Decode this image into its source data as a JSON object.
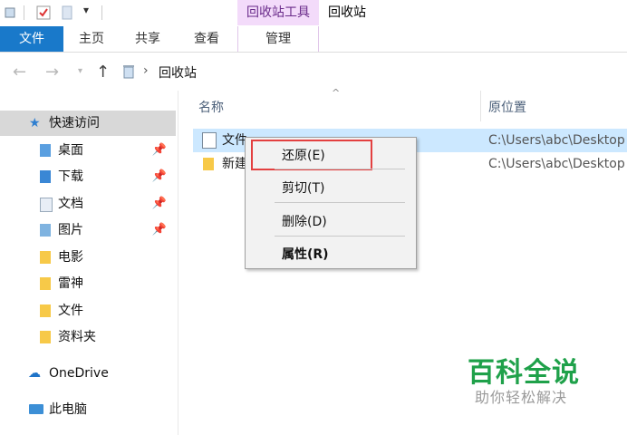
{
  "ribbon": {
    "context_group": "回收站工具",
    "window_title": "回收站",
    "tabs": [
      "文件",
      "主页",
      "共享",
      "查看",
      "管理"
    ]
  },
  "address": {
    "path": [
      "回收站"
    ]
  },
  "sidebar": {
    "items": [
      {
        "label": "快速访问",
        "icon": "star-icon",
        "pinned": false,
        "active": true
      },
      {
        "label": "桌面",
        "icon": "desktop-folder-icon",
        "pinned": true
      },
      {
        "label": "下载",
        "icon": "download-folder-icon",
        "pinned": true
      },
      {
        "label": "文档",
        "icon": "documents-folder-icon",
        "pinned": true
      },
      {
        "label": "图片",
        "icon": "pictures-folder-icon",
        "pinned": true
      },
      {
        "label": "电影",
        "icon": "folder-icon",
        "pinned": false
      },
      {
        "label": "雷神",
        "icon": "folder-icon",
        "pinned": false
      },
      {
        "label": "文件",
        "icon": "folder-icon",
        "pinned": false
      },
      {
        "label": "资料夹",
        "icon": "folder-icon",
        "pinned": false
      },
      {
        "label": "OneDrive",
        "icon": "cloud-icon",
        "pinned": false
      },
      {
        "label": "此电脑",
        "icon": "computer-icon",
        "pinned": false
      }
    ]
  },
  "list": {
    "columns": [
      "名称",
      "原位置"
    ],
    "rows": [
      {
        "name": "文件",
        "location": "C:\\Users\\abc\\Desktop",
        "selected": true,
        "icon": "document-icon"
      },
      {
        "name": "新建",
        "location": "C:\\Users\\abc\\Desktop",
        "selected": false,
        "icon": "folder-icon"
      }
    ]
  },
  "context_menu": {
    "items": [
      "还原(E)",
      "剪切(T)",
      "删除(D)",
      "属性(R)"
    ]
  },
  "watermark": {
    "title": "百科全说",
    "subtitle": "助你轻松解决"
  },
  "colors": {
    "file_tab": "#1979ca",
    "context_tab": "#f3dbfa",
    "selection": "#cce8ff",
    "highlight_box": "#e34040",
    "watermark_green": "#1fa14a"
  }
}
